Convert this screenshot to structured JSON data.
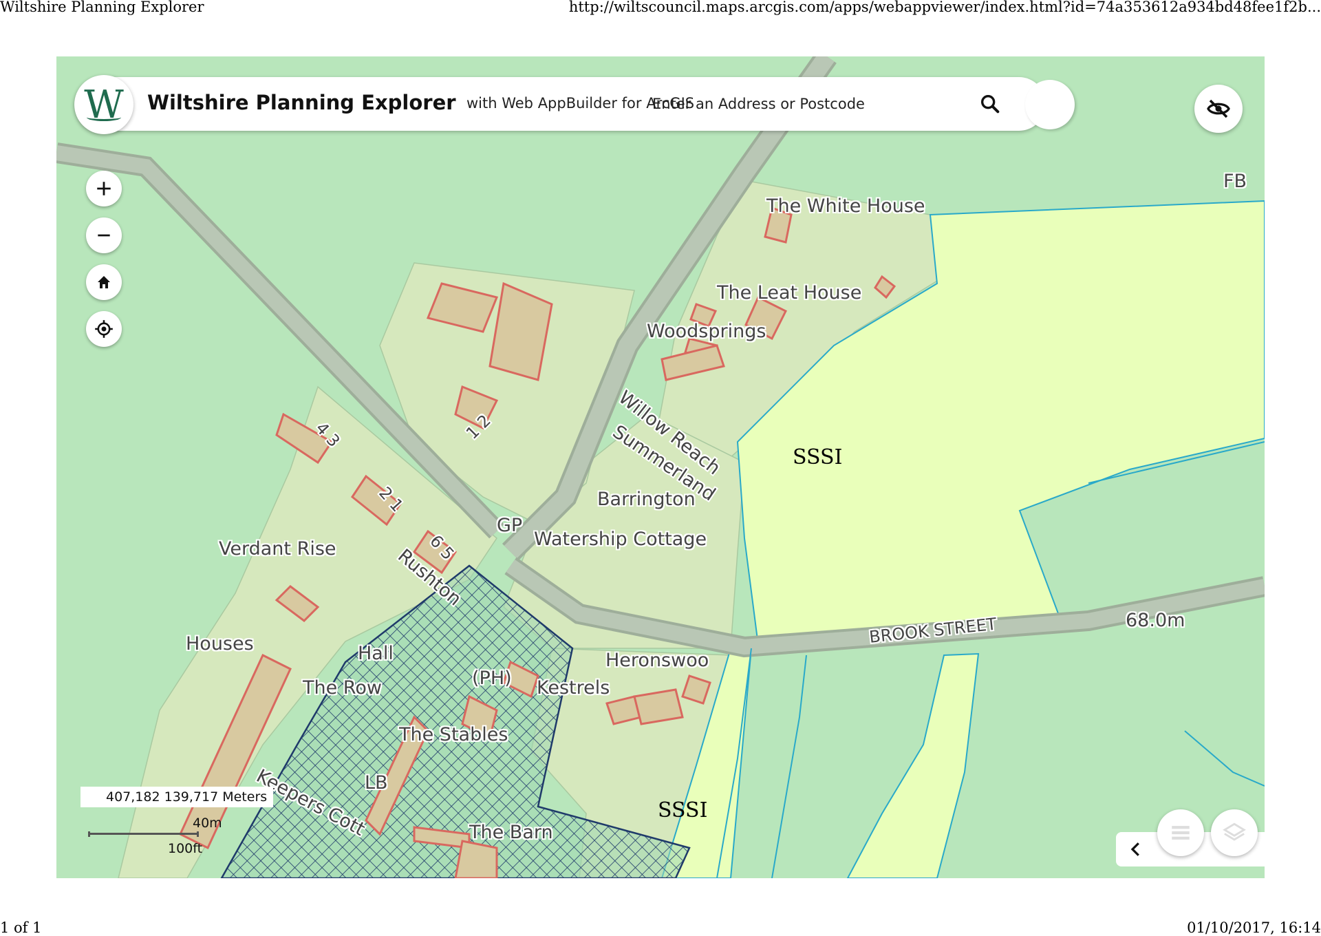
{
  "print": {
    "title": "Wiltshire Planning Explorer",
    "url": "http://wiltscouncil.maps.arcgis.com/apps/webappviewer/index.html?id=74a353612a934bd48fee1f2b...",
    "page": "1 of 1",
    "datetime": "01/10/2017, 16:14"
  },
  "app": {
    "logo_letter": "W",
    "title": "Wiltshire Planning Explorer",
    "subtitle": "with Web AppBuilder for ArcGIS",
    "search_placeholder": "Enter an Address or Postcode"
  },
  "map": {
    "labels": {
      "white_house": "The White House",
      "leat_house": "The Leat House",
      "woodsprings": "Woodsprings",
      "willow_reach": "Willow Reach",
      "summerland": "Summerland",
      "barrington": "Barrington",
      "watership": "Watership Cottage",
      "gp": "GP",
      "rushton": "Rushton",
      "verdant_rise": "Verdant Rise",
      "houses": "Houses",
      "hall": "Hall",
      "the_row": "The Row",
      "ph": "(PH)",
      "kestrels": "Kestrels",
      "heronswood": "Heronswoo",
      "the_stables": "The Stables",
      "lb": "LB",
      "keepers": "Keepers Cott",
      "the_barn": "The Barn",
      "fb": "FB",
      "height": "68.0m",
      "brook_street": "BROOK STREET",
      "n43": "4 3",
      "n12": "1 2",
      "n21": "2 1",
      "n65": "6 5"
    },
    "sssi_labels": [
      "SSSI",
      "SSSI"
    ],
    "coordinates": "407,182 139,717 Meters",
    "scale": {
      "metric": "40m",
      "imperial": "100ft"
    }
  },
  "colors": {
    "field_green": "#b8e6bb",
    "plot_beige": "#d6e8bd",
    "sssi_yellow": "#e9ffba",
    "road_grey": "#b9c7b5",
    "building_outline": "#d9685f",
    "building_fill": "#d8c9a0",
    "hatch_blue": "#1f3a6a",
    "water_line": "#29a9c9"
  }
}
